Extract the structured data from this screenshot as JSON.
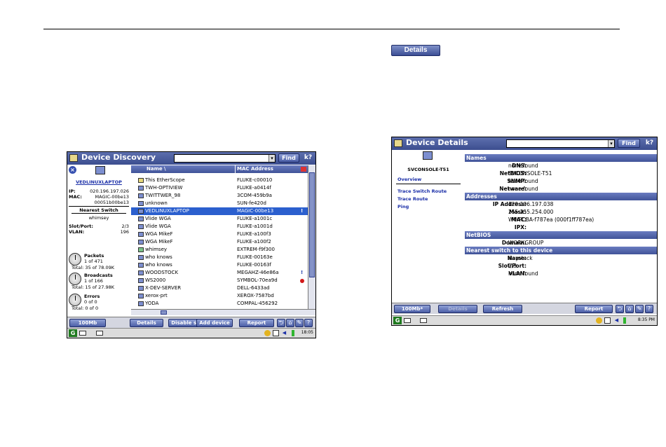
{
  "page": {
    "details_button_label": "Details"
  },
  "discovery": {
    "title": "Device Discovery",
    "find_label": "Find",
    "help_icon": "k?",
    "selected_device": {
      "name": "VEDLINUXLAPTOP",
      "ip_label": "IP:",
      "ip": "020.196.197.026",
      "mac_label": "MAC:",
      "mac_line1": "MAGIC-00be13",
      "mac_line2": "00051b00be13",
      "nearest_switch_heading": "Nearest Switch",
      "switch_name": "whimsey",
      "slot_label": "Slot/Port:",
      "slot": "2/3",
      "vlan_label": "VLAN:",
      "vlan": "196"
    },
    "stats": [
      {
        "label": "Packets",
        "line1": "1 of 471",
        "line2": "Total: 35 of 78.09K"
      },
      {
        "label": "Broadcasts",
        "line1": "1 of 166",
        "line2": "Total: 15 of 27.98K"
      },
      {
        "label": "Errors",
        "line1": "0 of 0",
        "line2": "Total: 0 of 0"
      }
    ],
    "columns": {
      "name": "Name  \\",
      "mac": "MAC Address"
    },
    "rows": [
      {
        "name": "This EtherScope",
        "mac": "FLUKE-c00010",
        "icon": "yel",
        "mark": ""
      },
      {
        "name": "TWH-OPTIVIEW",
        "mac": "FLUKE-a0414f",
        "icon": "blue",
        "mark": ""
      },
      {
        "name": "TWITTWER_98",
        "mac": "3COM-459b9a",
        "icon": "blue",
        "mark": ""
      },
      {
        "name": "unknown",
        "mac": "SUN-fe420d",
        "icon": "blue",
        "mark": ""
      },
      {
        "name": "VEDLINUXLAPTOP",
        "mac": "MAGIC-00be13",
        "icon": "blue",
        "mark": "!",
        "selected": true
      },
      {
        "name": "Vlide WGA",
        "mac": "FLUKE-a1001c",
        "icon": "blue",
        "mark": ""
      },
      {
        "name": "Vlide WGA",
        "mac": "FLUKE-a1001d",
        "icon": "blue",
        "mark": ""
      },
      {
        "name": "WGA MikeF",
        "mac": "FLUKE-a100f3",
        "icon": "blue",
        "mark": ""
      },
      {
        "name": "WGA MikeF",
        "mac": "FLUKE-a100f2",
        "icon": "blue",
        "mark": ""
      },
      {
        "name": "whimsey",
        "mac": "EXTREM-f9f300",
        "icon": "grn",
        "mark": ""
      },
      {
        "name": "who knows",
        "mac": "FLUKE-00163e",
        "icon": "blue",
        "mark": ""
      },
      {
        "name": "who knows",
        "mac": "FLUKE-00163f",
        "icon": "blue",
        "mark": ""
      },
      {
        "name": "WOODSTOCK",
        "mac": "MEGAHZ-46e86a",
        "icon": "blue",
        "mark": "!"
      },
      {
        "name": "WS2000",
        "mac": "SYMBOL-70ea9d",
        "icon": "blue",
        "mark": "dot"
      },
      {
        "name": "X-DEV-SERVER",
        "mac": "DELL-6433ad",
        "icon": "blue",
        "mark": ""
      },
      {
        "name": "xerox-prt",
        "mac": "XEROX-7587bd",
        "icon": "blue",
        "mark": ""
      },
      {
        "name": "YODA",
        "mac": "COMPAL-456292",
        "icon": "blue",
        "mark": ""
      }
    ],
    "toolbar": [
      "100Mb",
      "Details",
      "Disable sort",
      "Add device",
      "Report"
    ],
    "time": "18:05"
  },
  "details": {
    "title": "Device Details",
    "find_label": "Find",
    "help_icon": "k?",
    "device_name": "SVCONSOLE-T51",
    "nav": [
      "Overview",
      "Trace Switch Route",
      "Trace Route",
      "Ping"
    ],
    "sections": [
      {
        "title": "Names",
        "items": [
          {
            "k": "DNS:",
            "v": "none found"
          },
          {
            "k": "NetBIOS:",
            "v": "SVCONSOLE-T51"
          },
          {
            "k": "SNMP:",
            "v": "none found"
          },
          {
            "k": "Netware:",
            "v": "none found"
          }
        ]
      },
      {
        "title": "Addresses",
        "items": [
          {
            "k": "IP Address:",
            "v": "129.196.197.038"
          },
          {
            "k": "Mask:",
            "v": "255.255.254.000"
          },
          {
            "k": "MAC:",
            "v": "WWPCBA-f787ea (000f1ff787ea)"
          },
          {
            "k": "IPX:",
            "v": ""
          }
        ]
      },
      {
        "title": "NetBIOS",
        "items": [
          {
            "k": "Domain:",
            "v": "WORKGROUP"
          }
        ]
      },
      {
        "title": "Nearest switch to this device",
        "items": [
          {
            "k": "Name:",
            "v": "Haystack"
          },
          {
            "k": "Slot/Port:",
            "v": "2/3"
          },
          {
            "k": "VLAN:",
            "v": "none found"
          }
        ]
      }
    ],
    "toolbar": [
      "100Mb*",
      "Details",
      "Refresh",
      "Report"
    ],
    "time": "8:35 PM"
  }
}
